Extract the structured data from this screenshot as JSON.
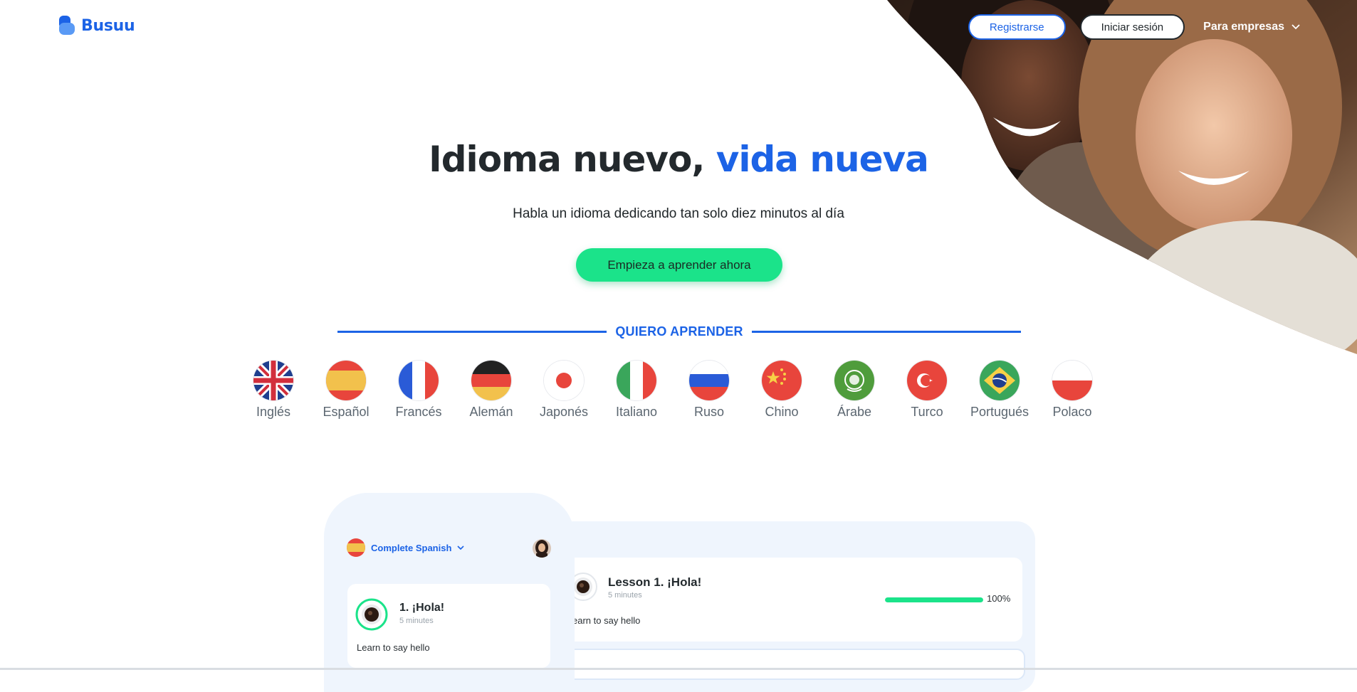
{
  "brand": {
    "name": "Busuu",
    "accent": "#1c63e6",
    "cta_color": "#1be38a"
  },
  "header": {
    "register_label": "Registrarse",
    "login_label": "Iniciar sesión",
    "business_label": "Para empresas"
  },
  "hero": {
    "headline_main": "Idioma nuevo, ",
    "headline_accent": "vida nueva",
    "subtitle": "Habla un idioma dedicando tan solo diez minutos al día",
    "cta_label": "Empieza a aprender ahora"
  },
  "learn": {
    "title": "QUIERO APRENDER",
    "languages": [
      {
        "label": "Inglés",
        "flag": "uk-flag-icon"
      },
      {
        "label": "Español",
        "flag": "spain-flag-icon"
      },
      {
        "label": "Francés",
        "flag": "france-flag-icon"
      },
      {
        "label": "Alemán",
        "flag": "germany-flag-icon"
      },
      {
        "label": "Japonés",
        "flag": "japan-flag-icon"
      },
      {
        "label": "Italiano",
        "flag": "italy-flag-icon"
      },
      {
        "label": "Ruso",
        "flag": "russia-flag-icon"
      },
      {
        "label": "Chino",
        "flag": "china-flag-icon"
      },
      {
        "label": "Árabe",
        "flag": "arab-league-flag-icon"
      },
      {
        "label": "Turco",
        "flag": "turkey-flag-icon"
      },
      {
        "label": "Portugués",
        "flag": "brazil-flag-icon"
      },
      {
        "label": "Polaco",
        "flag": "poland-flag-icon"
      }
    ]
  },
  "preview": {
    "course_name": "Complete Spanish",
    "lesson": {
      "title": "Lesson 1. ¡Hola!",
      "duration": "5 minutes",
      "description": "Learn to say hello",
      "description_visible": "earn to say hello",
      "progress": 1.0,
      "progress_label": "100%"
    },
    "phone_lesson": {
      "title": "1. ¡Hola!",
      "duration": "5 minutes",
      "description": "Learn to say hello"
    }
  }
}
